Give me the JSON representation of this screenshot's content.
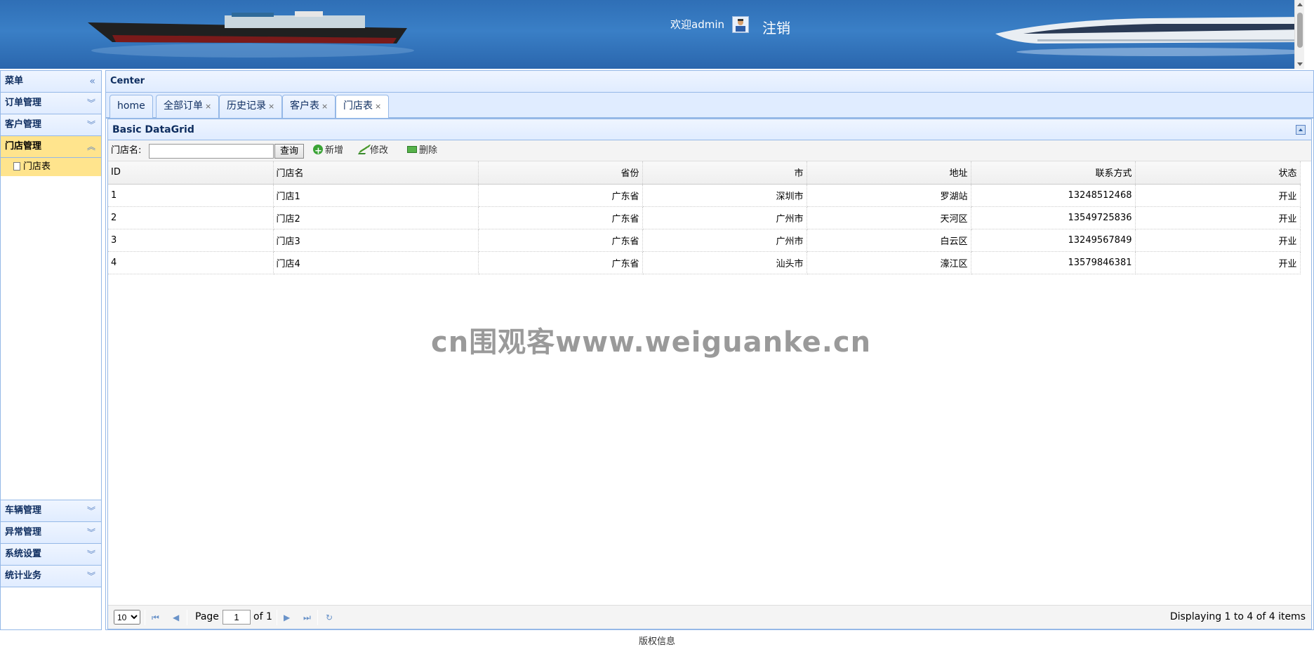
{
  "header": {
    "welcome": "欢迎admin",
    "logout": "注销"
  },
  "menu": {
    "title": "菜单",
    "items": [
      {
        "label": "订单管理"
      },
      {
        "label": "客户管理"
      },
      {
        "label": "门店管理",
        "active": true,
        "children": [
          {
            "label": "门店表"
          }
        ]
      },
      {
        "label": "车辆管理"
      },
      {
        "label": "异常管理"
      },
      {
        "label": "系统设置"
      },
      {
        "label": "统计业务"
      }
    ]
  },
  "center": {
    "title": "Center",
    "tabs": [
      "home",
      "全部订单",
      "历史记录",
      "客户表",
      "门店表"
    ],
    "selected_tab": "门店表",
    "grid": {
      "title": "Basic DataGrid",
      "search_label": "门店名:",
      "search_value": "",
      "query_label": "查询",
      "add_label": "新增",
      "edit_label": "修改",
      "delete_label": "删除",
      "columns": [
        "ID",
        "门店名",
        "省份",
        "市",
        "地址",
        "联系方式",
        "状态"
      ],
      "rows": [
        [
          "1",
          "门店1",
          "广东省",
          "深圳市",
          "罗湖站",
          "13248512468",
          "开业"
        ],
        [
          "2",
          "门店2",
          "广东省",
          "广州市",
          "天河区",
          "13549725836",
          "开业"
        ],
        [
          "3",
          "门店3",
          "广东省",
          "广州市",
          "白云区",
          "13249567849",
          "开业"
        ],
        [
          "4",
          "门店4",
          "广东省",
          "汕头市",
          "濠江区",
          "13579846381",
          "开业"
        ]
      ],
      "watermark": "cn围观客www.weiguanke.cn"
    },
    "pager": {
      "page_size": "10",
      "page_label": "Page",
      "page_value": "1",
      "of_label": "of 1",
      "display": "Displaying 1 to 4 of 4 items"
    }
  },
  "footer": {
    "text": "版权信息"
  },
  "colors": {
    "header_blue": "#3a7fc6",
    "panel_border": "#95b8e7",
    "active_yellow": "#ffe48d"
  }
}
